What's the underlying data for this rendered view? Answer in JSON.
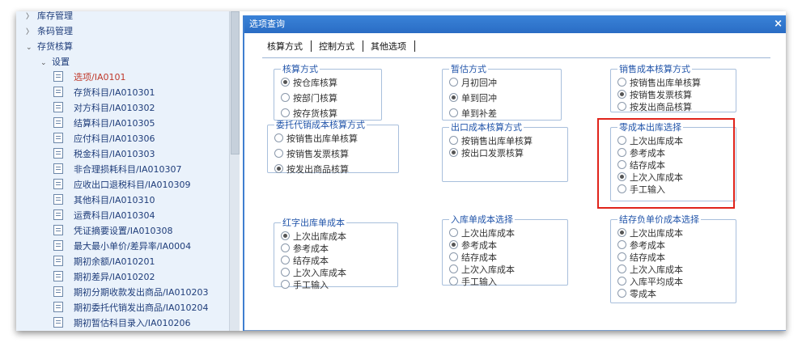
{
  "sidebar": {
    "top_cut": "库存管理",
    "barcode": "条码管理",
    "inventory_accounting": "存货核算",
    "settings": "设置",
    "items": [
      "选项/IA0101",
      "存货科目/IA010301",
      "对方科目/IA010302",
      "结算科目/IA010305",
      "应付科目/IA010306",
      "税金科目/IA010303",
      "非合理损耗科目/IA010307",
      "应收出口退税科目/IA010309",
      "其他科目/IA010310",
      "运费科目/IA010304",
      "凭证摘要设置/IA010308",
      "最大最小单价/差异率/IA0004",
      "期初余额/IA010201",
      "期初差异/IA010202",
      "期初分期收款发出商品/IA010203",
      "期初委托代销发出商品/IA010204",
      "期初暂估科目录入/IA010206"
    ]
  },
  "dialog": {
    "title": "选项查询",
    "close": "×",
    "tabs": [
      "核算方式",
      "控制方式",
      "其他选项"
    ],
    "groups": {
      "costing_method": {
        "title": "核算方式",
        "options": [
          "按仓库核算",
          "按部门核算",
          "按存货核算"
        ],
        "selected": 0
      },
      "temp_estimate": {
        "title": "暂估方式",
        "options": [
          "月初回冲",
          "单到回冲",
          "单到补差"
        ],
        "selected": 1
      },
      "sales_cost": {
        "title": "销售成本核算方式",
        "options": [
          "按销售出库单核算",
          "按销售发票核算",
          "按发出商品核算"
        ],
        "selected": 1
      },
      "consignment_cost": {
        "title": "委托代销成本核算方式",
        "options": [
          "按销售出库单核算",
          "按销售发票核算",
          "按发出商品核算"
        ],
        "selected": 2
      },
      "export_cost": {
        "title": "出口成本核算方式",
        "options": [
          "按销售出库单核算",
          "按出口发票核算"
        ],
        "selected": 1
      },
      "zero_cost": {
        "title": "零成本出库选择",
        "options": [
          "上次出库成本",
          "参考成本",
          "结存成本",
          "上次入库成本",
          "手工输入"
        ],
        "selected": 3
      },
      "red_out_cost": {
        "title": "红字出库单成本",
        "options": [
          "上次出库成本",
          "参考成本",
          "结存成本",
          "上次入库成本",
          "手工输入"
        ],
        "selected": 0
      },
      "in_cost": {
        "title": "入库单成本选择",
        "options": [
          "上次出库成本",
          "参考成本",
          "结存成本",
          "上次入库成本",
          "手工输入"
        ],
        "selected": 1
      },
      "neg_balance_cost": {
        "title": "结存负单价成本选择",
        "options": [
          "上次出库成本",
          "参考成本",
          "结存成本",
          "上次入库成本",
          "入库平均成本",
          "零成本"
        ],
        "selected": 0
      }
    }
  },
  "colors": {
    "titlebar": "#2f74cc",
    "legend": "#2255aa",
    "highlight": "#e0241b",
    "active_item": "#c0392b"
  }
}
